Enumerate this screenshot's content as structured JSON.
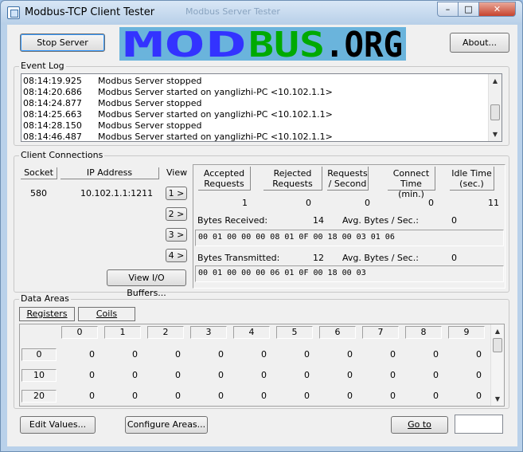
{
  "window": {
    "title": "Modbus-TCP Client Tester",
    "background_title": "Modbus Server Tester",
    "min_glyph": "–",
    "max_glyph": "□",
    "close_glyph": "✕"
  },
  "top": {
    "stop_server_label": "Stop Server",
    "logo_text": "MODBUS.ORG",
    "about_label": "About..."
  },
  "colors": {
    "logo_blue": "#3333ff",
    "logo_green": "#00aa00",
    "logo_black": "#000000",
    "logo_bg": "#6ab4dc"
  },
  "event_log": {
    "label": "Event Log",
    "entries": [
      {
        "time": "08:14:19.925",
        "message": "Modbus Server stopped"
      },
      {
        "time": "08:14:20.686",
        "message": "Modbus Server started on yanglizhi-PC <10.102.1.1>"
      },
      {
        "time": "08:14:24.877",
        "message": "Modbus Server stopped"
      },
      {
        "time": "08:14:25.663",
        "message": "Modbus Server started on yanglizhi-PC <10.102.1.1>"
      },
      {
        "time": "08:14:28.150",
        "message": "Modbus Server stopped"
      },
      {
        "time": "08:14:46.487",
        "message": "Modbus Server started on yanglizhi-PC <10.102.1.1>"
      }
    ]
  },
  "client_connections": {
    "label": "Client Connections",
    "headers": {
      "socket": "Socket",
      "ip": "IP Address",
      "view": "View"
    },
    "rows": [
      {
        "socket": "580",
        "ip": "10.102.1.1:1211"
      }
    ],
    "view_buttons": [
      "1 >",
      "2 >",
      "3 >",
      "4 >"
    ],
    "view_io_label": "View I/O Buffers...",
    "stats_headers": [
      {
        "line1": "Accepted",
        "line2": "Requests"
      },
      {
        "line1": "Rejected",
        "line2": "Requests"
      },
      {
        "line1": "Requests",
        "line2": "/ Second"
      },
      {
        "line1": "Connect",
        "line2": "Time (min.)"
      },
      {
        "line1": "Idle Time",
        "line2": "(sec.)"
      }
    ],
    "stats_values": [
      "1",
      "0",
      "0",
      "0",
      "11"
    ],
    "bytes_received_label": "Bytes Received:",
    "bytes_received": "14",
    "avg_received_label": "Avg. Bytes / Sec.:",
    "avg_received": "0",
    "rx_hex": "00 01 00 00 00 08 01 0F 00 18 00 03 01 06",
    "bytes_transmitted_label": "Bytes Transmitted:",
    "bytes_transmitted": "12",
    "avg_transmitted_label": "Avg. Bytes / Sec.:",
    "avg_transmitted": "0",
    "tx_hex": "00 01 00 00 00 06 01 0F 00 18 00 03"
  },
  "data_areas": {
    "label": "Data Areas",
    "tabs": [
      "Registers",
      "Coils"
    ],
    "columns": [
      "0",
      "1",
      "2",
      "3",
      "4",
      "5",
      "6",
      "7",
      "8",
      "9"
    ],
    "rows": [
      {
        "label": "0",
        "values": [
          "0",
          "0",
          "0",
          "0",
          "0",
          "0",
          "0",
          "0",
          "0",
          "0"
        ]
      },
      {
        "label": "10",
        "values": [
          "0",
          "0",
          "0",
          "0",
          "0",
          "0",
          "0",
          "0",
          "0",
          "0"
        ]
      },
      {
        "label": "20",
        "values": [
          "0",
          "0",
          "0",
          "0",
          "0",
          "0",
          "0",
          "0",
          "0",
          "0"
        ]
      }
    ]
  },
  "bottom": {
    "edit_values_label": "Edit Values...",
    "configure_areas_label": "Configure Areas...",
    "goto_label": "Go to",
    "goto_value": ""
  }
}
